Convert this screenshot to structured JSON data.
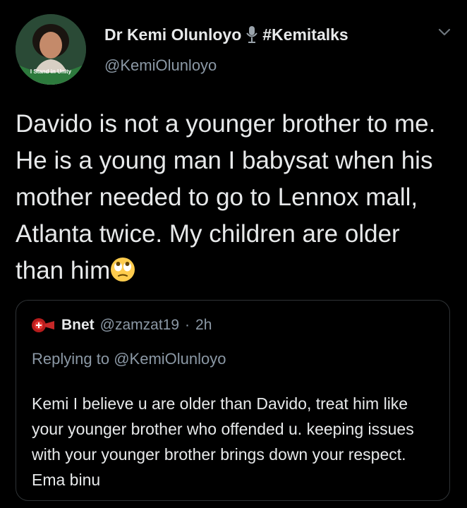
{
  "tweet": {
    "author_name": "Dr Kemi Olunloyo",
    "name_hashtag": "#Kemitalks",
    "handle": "@KemiOlunloyo",
    "avatar_caption": "I Stand in Unity",
    "text": "Davido is not a younger brother to me. He is a young man I babysat when his mother needed to go to Lennox mall, Atlanta twice. My children are older than him",
    "emoji": "eye-roll-emoji"
  },
  "quoted": {
    "author_name": "Bnet",
    "handle": "@zamzat19",
    "separator": "·",
    "time": "2h",
    "replying_to_label": "Replying to",
    "replying_to_handle": "@KemiOlunloyo",
    "text": "Kemi I believe u are older than Davido, treat him like your younger brother who offended u. keeping issues with your younger brother brings down your respect. Ema binu"
  },
  "colors": {
    "background": "#000000",
    "primary_text": "#e7e9ea",
    "secondary_text": "#8b98a5",
    "border": "#2f3336"
  }
}
